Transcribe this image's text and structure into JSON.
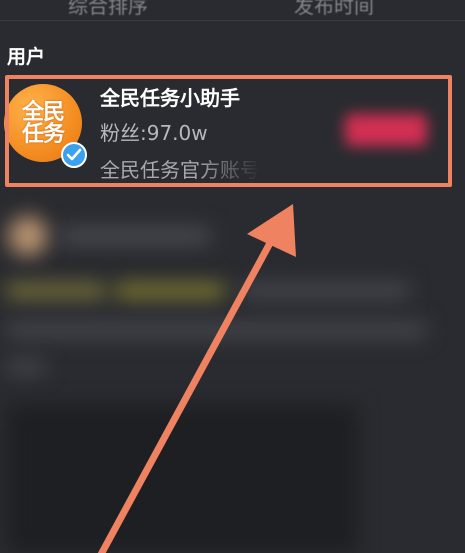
{
  "top_tabs": [
    "综合排序",
    "发布时间"
  ],
  "section": {
    "title": "用户"
  },
  "user": {
    "name": "全民任务小助手",
    "followers": "粉丝:97.0w",
    "bio": "全民任务官方账号",
    "avatar_text": "全民\n任务",
    "avatar_color": "#f28a1f",
    "verified_color": "#3aa0f0",
    "verified_icon": "check-icon"
  },
  "follow_button_color": "#f0305a",
  "annotation": {
    "box_color": "#ef8260",
    "arrow_color": "#ef8260"
  }
}
